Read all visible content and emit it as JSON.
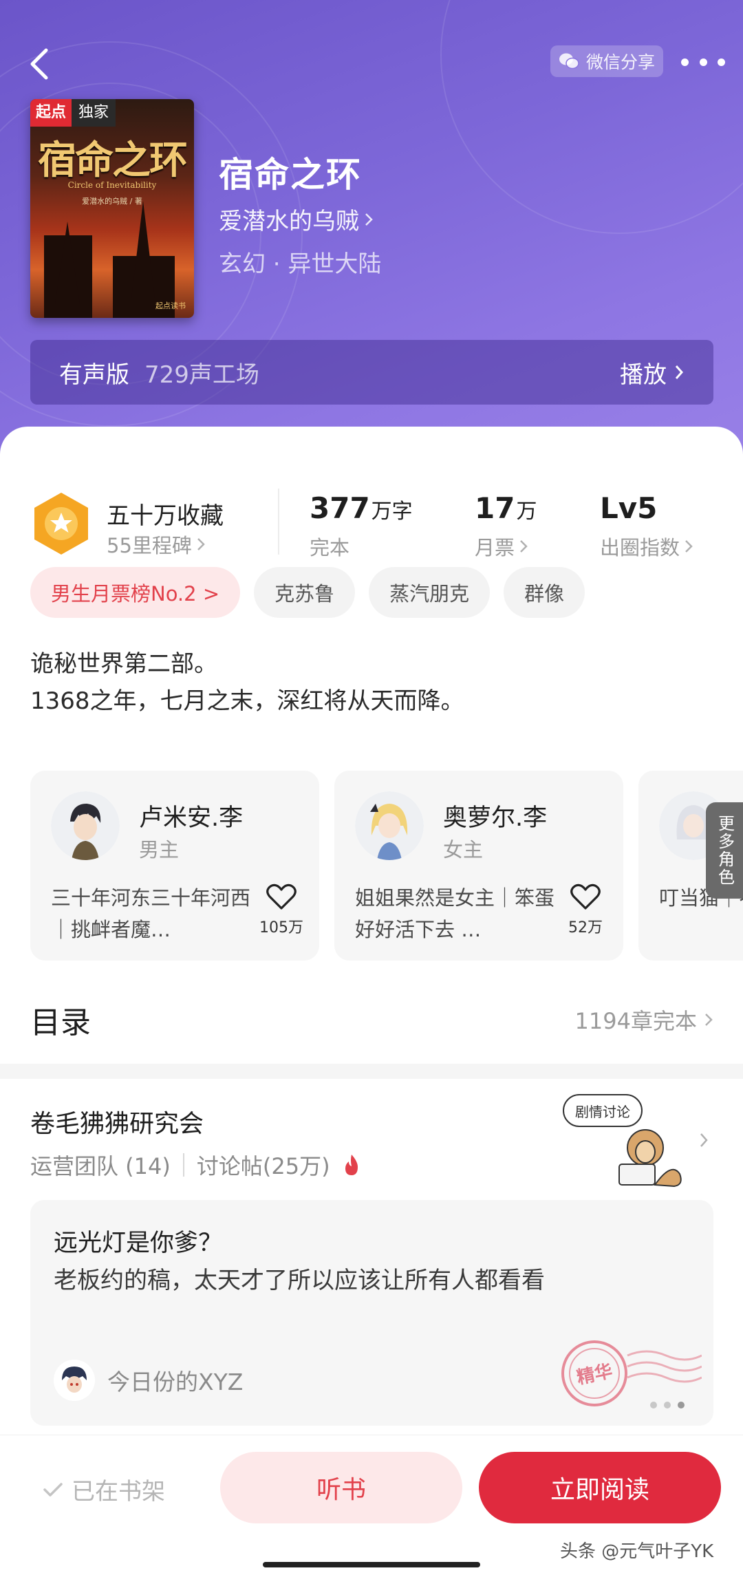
{
  "header": {
    "share_label": "微信分享"
  },
  "book": {
    "cover_badge_brand": "起点",
    "cover_badge_exclusive": "独家",
    "cover_title_art": "宿命之环",
    "cover_subtitle_art": "Circle of Inevitability",
    "cover_author_art": "爱潜水的乌贼 / 著",
    "cover_publisher_art": "起点读书",
    "title": "宿命之环",
    "author": "爱潜水的乌贼",
    "genre": "玄幻 · 异世大陆"
  },
  "audio": {
    "label": "有声版",
    "studio": "729声工场",
    "play_label": "播放"
  },
  "stats": {
    "collect_title": "五十万收藏",
    "collect_sub": "55里程碑",
    "words_value": "377",
    "words_unit": "万字",
    "words_label": "完本",
    "tickets_value": "17",
    "tickets_unit": "万",
    "tickets_label": "月票",
    "level_value": "Lv5",
    "level_label": "出圈指数"
  },
  "tags": [
    {
      "label": "男生月票榜No.2 >",
      "hot": true
    },
    {
      "label": "克苏鲁",
      "hot": false
    },
    {
      "label": "蒸汽朋克",
      "hot": false
    },
    {
      "label": "群像",
      "hot": false
    }
  ],
  "intro": {
    "line1": "诡秘世界第二部。",
    "line2": "1368之年，七月之末，深红将从天而降。"
  },
  "characters": [
    {
      "name": "卢米安.李",
      "role": "男主",
      "desc": "三十年河东三十年河西｜挑衅者魔…",
      "likes": "105万"
    },
    {
      "name": "奥萝尔.李",
      "role": "女主",
      "desc": "姐姐果然是女主｜笨蛋好好活下去 …",
      "likes": "52万"
    },
    {
      "name": "",
      "role": "",
      "desc": "叮当猫｜不像个苟",
      "likes": ""
    }
  ],
  "more_characters": "更多角色",
  "toc": {
    "title": "目录",
    "chapters": "1194章完本"
  },
  "club": {
    "name": "卷毛狒狒研究会",
    "team": "运营团队 (14)",
    "posts": "讨论帖(25万)",
    "bubble": "剧情讨论"
  },
  "post": {
    "title": "远光灯是你爹？",
    "body": "老板约的稿，太天才了所以应该让所有人都看看",
    "user": "今日份的XYZ",
    "stamp": "精华"
  },
  "bottom": {
    "shelf_label": "已在书架",
    "listen_label": "听书",
    "read_label": "立即阅读",
    "watermark": "头条 @元气叶子YK"
  },
  "colors": {
    "hero_purple": "#7d67d8",
    "accent_red": "#e02a3e",
    "tag_red": "#e2414b",
    "medal_orange": "#f5a623"
  }
}
